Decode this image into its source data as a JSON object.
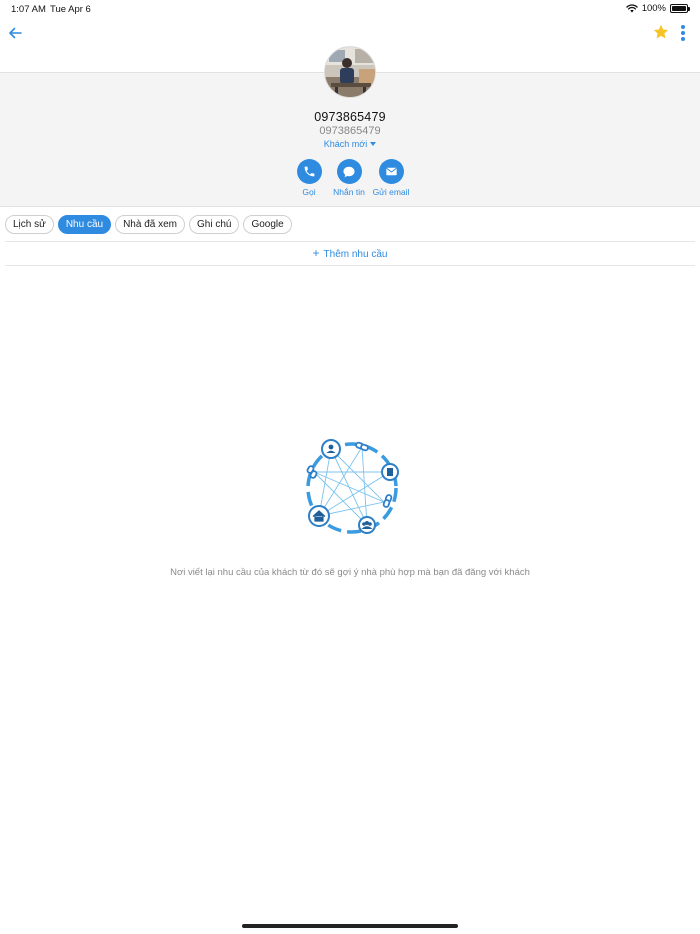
{
  "status_bar": {
    "time": "1:07 AM",
    "date": "Tue Apr 6",
    "battery": "100%"
  },
  "profile": {
    "name": "0973865479",
    "phone": "0973865479",
    "status_label": "Khách mới"
  },
  "actions": [
    {
      "label": "Gọi",
      "icon": "phone-icon"
    },
    {
      "label": "Nhắn tin",
      "icon": "chat-icon"
    },
    {
      "label": "Gửi email",
      "icon": "email-icon"
    }
  ],
  "tabs": [
    {
      "label": "Lịch sử",
      "active": false
    },
    {
      "label": "Nhu cầu",
      "active": true
    },
    {
      "label": "Nhà đã xem",
      "active": false
    },
    {
      "label": "Ghi chú",
      "active": false
    },
    {
      "label": "Google",
      "active": false
    }
  ],
  "add_need_label": "Thêm nhu cầu",
  "empty_state_text": "Nơi viết lại nhu cầu của khách từ đó sẽ gợi ý nhà phù hợp mà bạn đã đăng với khách",
  "colors": {
    "accent": "#2f8be0",
    "star": "#f7c325",
    "panel": "#f4f4f4"
  }
}
